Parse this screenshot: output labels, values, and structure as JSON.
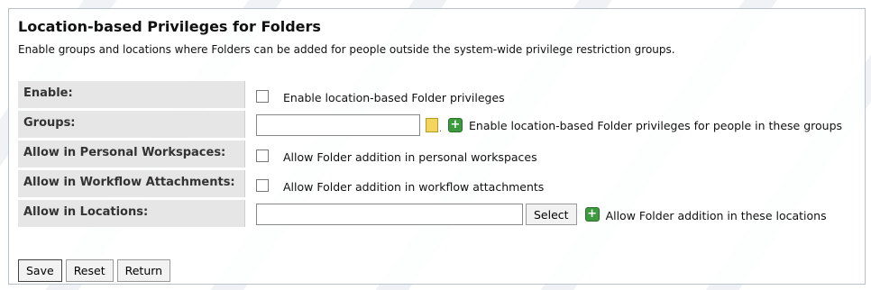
{
  "header": {
    "title": "Location-based Privileges for Folders",
    "description": "Enable groups and locations where Folders can be added for people outside the system-wide privilege restriction groups."
  },
  "rows": {
    "enable": {
      "label": "Enable:",
      "text": "Enable location-based Folder privileges"
    },
    "groups": {
      "label": "Groups:",
      "value": "",
      "text": "Enable location-based Folder privileges for people in these groups",
      "picker_icon": "user-picker-icon",
      "add_icon": "add-icon"
    },
    "personal": {
      "label": "Allow in Personal Workspaces:",
      "text": "Allow Folder addition in personal workspaces"
    },
    "workflow": {
      "label": "Allow in Workflow Attachments:",
      "text": "Allow Folder addition in workflow attachments"
    },
    "locations": {
      "label": "Allow in Locations:",
      "value": "",
      "select_label": "Select",
      "text": "Allow Folder addition in these locations",
      "add_icon": "add-icon"
    }
  },
  "buttons": {
    "save": "Save",
    "reset": "Reset",
    "return": "Return"
  },
  "colors": {
    "label_bg": "#e6e6e6",
    "border": "#b9c2cc",
    "add_icon_green": "#3c9b3c",
    "picker_icon_yellow": "#f3d55b"
  }
}
